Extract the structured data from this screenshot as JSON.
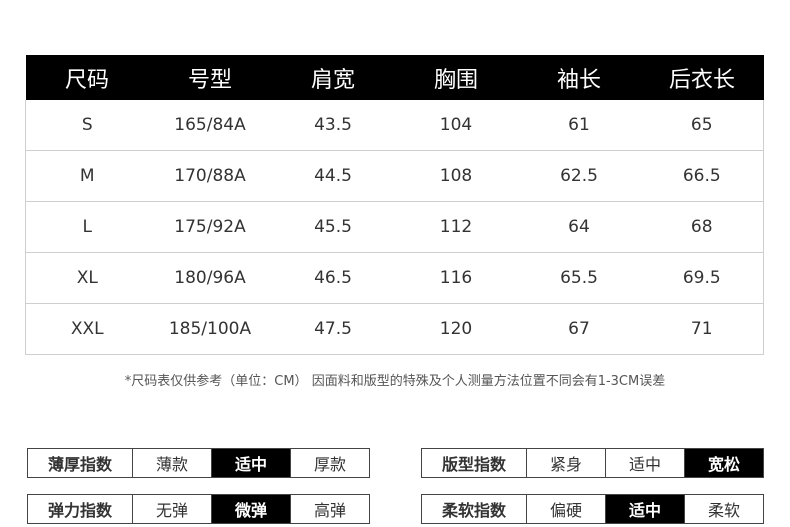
{
  "table": {
    "headers": [
      "尺码",
      "号型",
      "肩宽",
      "胸围",
      "袖长",
      "后衣长"
    ],
    "rows": [
      [
        "S",
        "165/84A",
        "43.5",
        "104",
        "61",
        "65"
      ],
      [
        "M",
        "170/88A",
        "44.5",
        "108",
        "62.5",
        "66.5"
      ],
      [
        "L",
        "175/92A",
        "45.5",
        "112",
        "64",
        "68"
      ],
      [
        "XL",
        "180/96A",
        "46.5",
        "116",
        "65.5",
        "69.5"
      ],
      [
        "XXL",
        "185/100A",
        "47.5",
        "120",
        "67",
        "71"
      ]
    ]
  },
  "note": "*尺码表仅供参考（单位：CM） 因面料和版型的特殊及个人测量方法位置不同会有1-3CM误差",
  "indices": [
    {
      "title": "薄厚指数",
      "options": [
        "薄款",
        "适中",
        "厚款"
      ],
      "selected": "适中"
    },
    {
      "title": "版型指数",
      "options": [
        "紧身",
        "适中",
        "宽松"
      ],
      "selected": "宽松"
    },
    {
      "title": "弹力指数",
      "options": [
        "无弹",
        "微弹",
        "高弹"
      ],
      "selected": "微弹"
    },
    {
      "title": "柔软指数",
      "options": [
        "偏硬",
        "适中",
        "柔软"
      ],
      "selected": "适中"
    }
  ],
  "colors": {
    "header_bg": "#000000",
    "selected_bg": "#000000",
    "border": "#cfcfcf"
  }
}
